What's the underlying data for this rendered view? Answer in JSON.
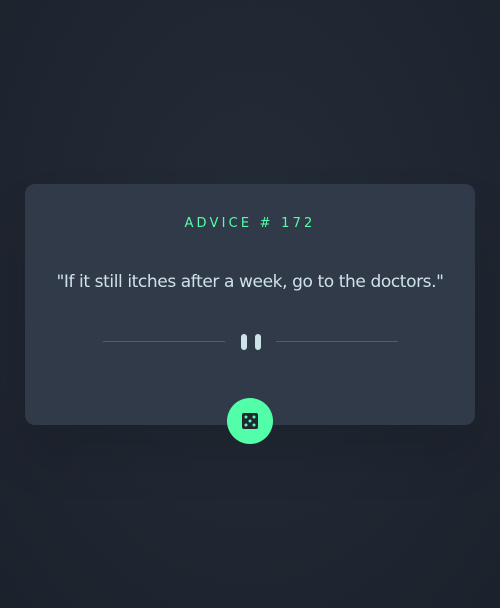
{
  "advice": {
    "heading": "ADVICE # 172",
    "quote": "\"If it still itches after a week, go to the doctors.\""
  },
  "icons": {
    "divider": "pause-icon",
    "button": "dice-icon"
  },
  "colors": {
    "background": "#1f2631",
    "card": "#313a48",
    "accent": "#52ffa8",
    "text": "#cee3e9",
    "divider": "#4f5d74"
  }
}
